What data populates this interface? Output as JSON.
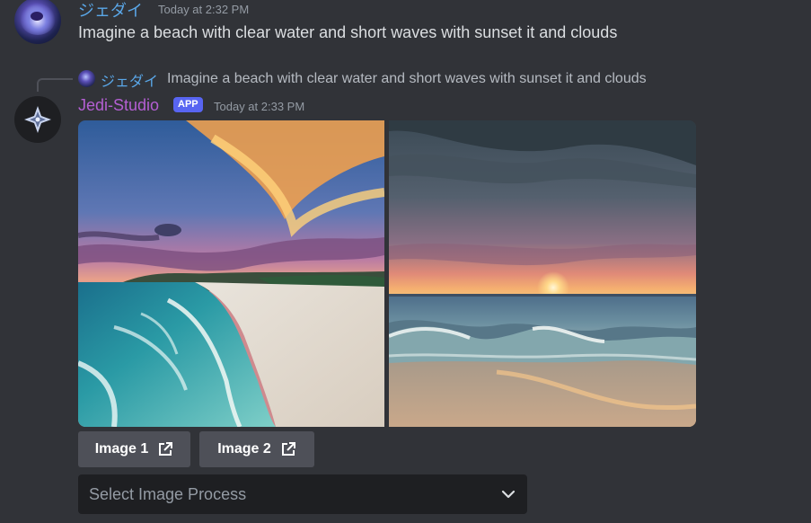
{
  "message1": {
    "author": "ジェダイ",
    "timestamp": "Today at 2:32 PM",
    "text": "Imagine a beach with clear water and  short waves with sunset it and clouds"
  },
  "reply": {
    "author": "ジェダイ",
    "text": "Imagine a beach with clear water and  short waves with sunset it and clouds"
  },
  "bot_message": {
    "author": "Jedi-Studio",
    "badge": "APP",
    "timestamp": "Today at 2:33 PM",
    "images": [
      "beach-aerial-sunset",
      "beach-waves-sunset"
    ],
    "buttons": [
      {
        "label": "Image 1",
        "icon": "external-link-icon"
      },
      {
        "label": "Image 2",
        "icon": "external-link-icon"
      }
    ],
    "select": {
      "placeholder": "Select Image Process",
      "icon": "chevron-down-icon"
    }
  },
  "colors": {
    "background": "#313338",
    "user_name": "#5aa7e8",
    "bot_name": "#b45fd3",
    "app_badge": "#5865f2",
    "button_bg": "#4e5058",
    "select_bg": "#1e1f22"
  }
}
